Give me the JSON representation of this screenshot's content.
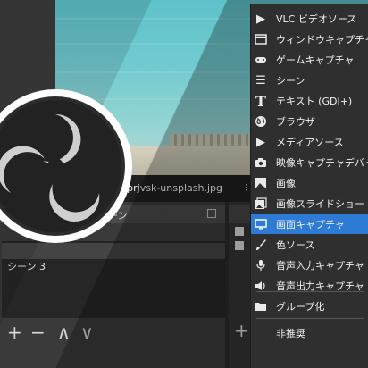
{
  "preview": {
    "source_name": "KEprjvsk-unsplash.jpg"
  },
  "scenes_panel": {
    "title": "シーン",
    "items": [
      "",
      "",
      "シーン 3"
    ]
  },
  "context_menu": {
    "items": [
      {
        "label": "VLC ビデオソース",
        "icon": "play-icon"
      },
      {
        "label": "ウィンドウキャプチャ",
        "icon": "window-icon"
      },
      {
        "label": "ゲームキャプチャ",
        "icon": "gamepad-icon"
      },
      {
        "label": "シーン",
        "icon": "list-icon"
      },
      {
        "label": "テキスト (GDI+)",
        "icon": "text-icon"
      },
      {
        "label": "ブラウザ",
        "icon": "globe-icon"
      },
      {
        "label": "メディアソース",
        "icon": "play-icon"
      },
      {
        "label": "映像キャプチャデバイス",
        "icon": "camera-icon"
      },
      {
        "label": "画像",
        "icon": "image-icon"
      },
      {
        "label": "画像スライドショー",
        "icon": "slideshow-icon"
      },
      {
        "label": "画面キャプチャ",
        "icon": "monitor-icon",
        "selected": true
      },
      {
        "label": "色ソース",
        "icon": "brush-icon"
      },
      {
        "label": "音声入力キャプチャ",
        "icon": "microphone-icon"
      },
      {
        "label": "音声出力キャプチャ",
        "icon": "speaker-icon"
      }
    ],
    "group_label": "グループ化",
    "deprecated_label": "非推奨"
  },
  "controls": {
    "add": "+",
    "remove": "−",
    "up": "∧",
    "down": "∨"
  },
  "colors": {
    "selection": "#2e7bd6",
    "menu_bg": "#2f2f2f",
    "panel_bg": "#3a3a3a"
  }
}
